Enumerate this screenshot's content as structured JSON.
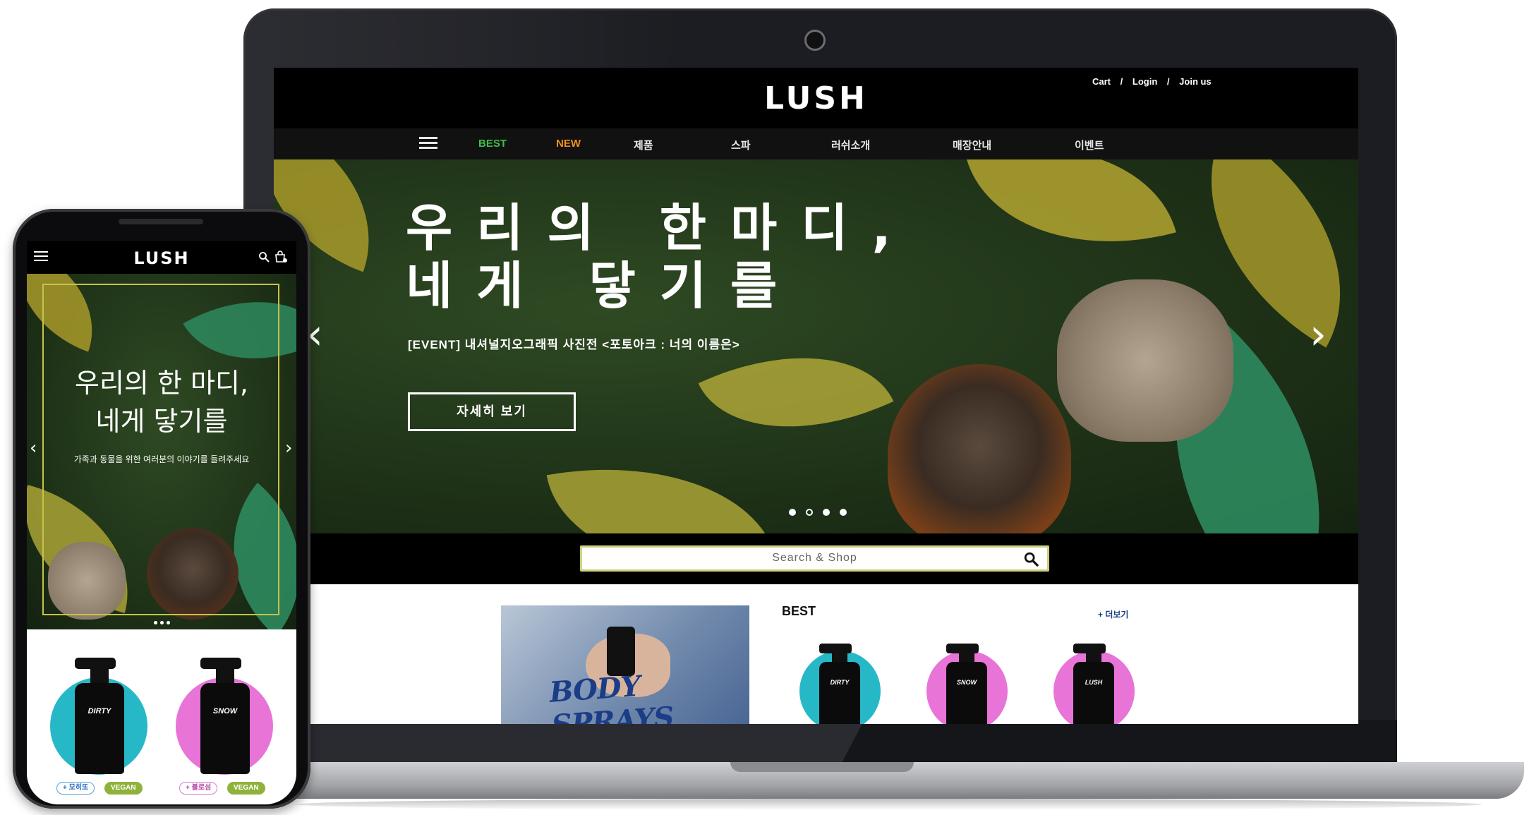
{
  "laptop": {
    "header": {
      "logo": "LUSH",
      "util": {
        "cart": "Cart",
        "login": "Login",
        "join": "Join us",
        "sep": "/"
      }
    },
    "nav": [
      {
        "label": "BEST",
        "color": "#3fbf4a"
      },
      {
        "label": "NEW",
        "color": "#f2901e"
      },
      {
        "label": "제품",
        "color": "#e6e6e6"
      },
      {
        "label": "스파",
        "color": "#e6e6e6"
      },
      {
        "label": "러쉬소개",
        "color": "#e6e6e6"
      },
      {
        "label": "매장안내",
        "color": "#e6e6e6"
      },
      {
        "label": "이벤트",
        "color": "#e6e6e6"
      }
    ],
    "hero": {
      "title": "우리의 한마디,\n네게 닿기를",
      "subtitle": "[EVENT] 내셔널지오그래픽 사진전 <포토아크 : 너의 이름은>",
      "button": "자세히 보기",
      "prev": "‹",
      "next": "›",
      "slides_total": 4,
      "slide_active": 2
    },
    "search": {
      "placeholder": "Search & Shop"
    },
    "promo": {
      "text": "BODY SPRAYS"
    },
    "best": {
      "title": "BEST",
      "more": "+ 더보기",
      "products": [
        {
          "bottle_text": "DIRTY",
          "accent": "#27b8c8"
        },
        {
          "bottle_text": "SNOW",
          "accent": "#e874d8"
        },
        {
          "bottle_text": "LUSH",
          "accent": "#e874d8"
        }
      ]
    }
  },
  "phone": {
    "header": {
      "logo": "LUSH"
    },
    "hero": {
      "title": "우리의 한 마디,\n네게 닿기를",
      "subtitle": "가족과 동물을 위한 여러분의 이야기를 들려주세요",
      "prev": "‹",
      "next": "›"
    },
    "products": [
      {
        "bottle_text": "DIRTY",
        "accent": "#27b8c8",
        "tag": "+ 모히또",
        "vegan": "VEGAN"
      },
      {
        "bottle_text": "SNOW",
        "accent": "#e874d8",
        "tag": "+ 블로섬",
        "vegan": "VEGAN"
      }
    ]
  },
  "colors": {
    "hero_green": "#1f3318",
    "frame_gold": "#c8c24a",
    "brand_black": "#000000"
  }
}
